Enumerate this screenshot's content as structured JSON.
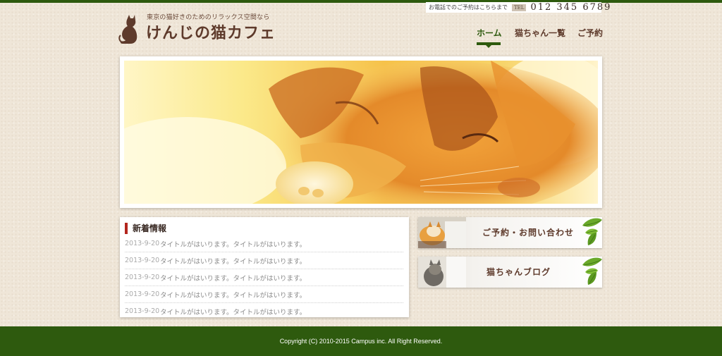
{
  "header": {
    "tagline": "東京の猫好きのためのリラックス空間なら",
    "site_title": "けんじの猫カフェ",
    "logo_icon": "cat-silhouette-icon",
    "phone": {
      "note": "お電話でのご予約はこちらまで",
      "tel_label": "TEL",
      "number": "012 345 6789"
    }
  },
  "nav": {
    "items": [
      {
        "label": "ホーム",
        "active": true
      },
      {
        "label": "猫ちゃん一覧",
        "active": false
      },
      {
        "label": "ご予約",
        "active": false
      }
    ]
  },
  "hero": {
    "image_subject": "sleeping orange tabby kitten on cream rug"
  },
  "news": {
    "title": "新着情報",
    "items": [
      {
        "date": "2013-9-20",
        "text": "タイトルがはいります。タイトルがはいります。"
      },
      {
        "date": "2013-9-20",
        "text": "タイトルがはいります。タイトルがはいります。"
      },
      {
        "date": "2013-9-20",
        "text": "タイトルがはいります。タイトルがはいります。"
      },
      {
        "date": "2013-9-20",
        "text": "タイトルがはいります。タイトルがはいります。"
      },
      {
        "date": "2013-9-20",
        "text": "タイトルがはいります。タイトルがはいります。"
      }
    ]
  },
  "banners": [
    {
      "label": "ご予約・お問い合わせ",
      "icon": "leaf-icon"
    },
    {
      "label": "猫ちゃんブログ",
      "icon": "leaf-icon"
    }
  ],
  "footer": {
    "copyright": "Copyright (C) 2010-2015 Campus inc. All Right Reserved."
  },
  "colors": {
    "brand_green": "#2e5a0e",
    "title_brown": "#5e3a2b",
    "news_accent_red": "#b3261e",
    "background": "#efe6d8"
  }
}
